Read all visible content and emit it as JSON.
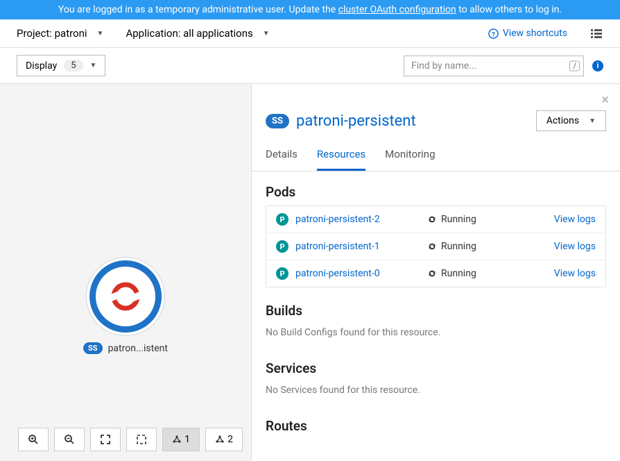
{
  "banner": {
    "prefix": "You are logged in as a temporary administrative user. Update the ",
    "link": "cluster OAuth configuration",
    "suffix": " to allow others to log in."
  },
  "toolbar": {
    "project_label": "Project: patroni",
    "app_label": "Application: all applications",
    "shortcuts": "View shortcuts"
  },
  "filter": {
    "display_label": "Display",
    "display_count": "5",
    "search_placeholder": "Find by name...",
    "slash": "/"
  },
  "canvas": {
    "badge": "SS",
    "label": "patron...istent",
    "topology1": "1",
    "topology2": "2"
  },
  "panel": {
    "badge": "SS",
    "title": "patroni-persistent",
    "actions": "Actions",
    "tabs": {
      "details": "Details",
      "resources": "Resources",
      "monitoring": "Monitoring"
    },
    "sections": {
      "pods": {
        "title": "Pods",
        "rows": [
          {
            "name": "patroni-persistent-2",
            "status": "Running",
            "logs": "View logs"
          },
          {
            "name": "patroni-persistent-1",
            "status": "Running",
            "logs": "View logs"
          },
          {
            "name": "patroni-persistent-0",
            "status": "Running",
            "logs": "View logs"
          }
        ]
      },
      "builds": {
        "title": "Builds",
        "empty": "No Build Configs found for this resource."
      },
      "services": {
        "title": "Services",
        "empty": "No Services found for this resource."
      },
      "routes": {
        "title": "Routes"
      }
    }
  }
}
